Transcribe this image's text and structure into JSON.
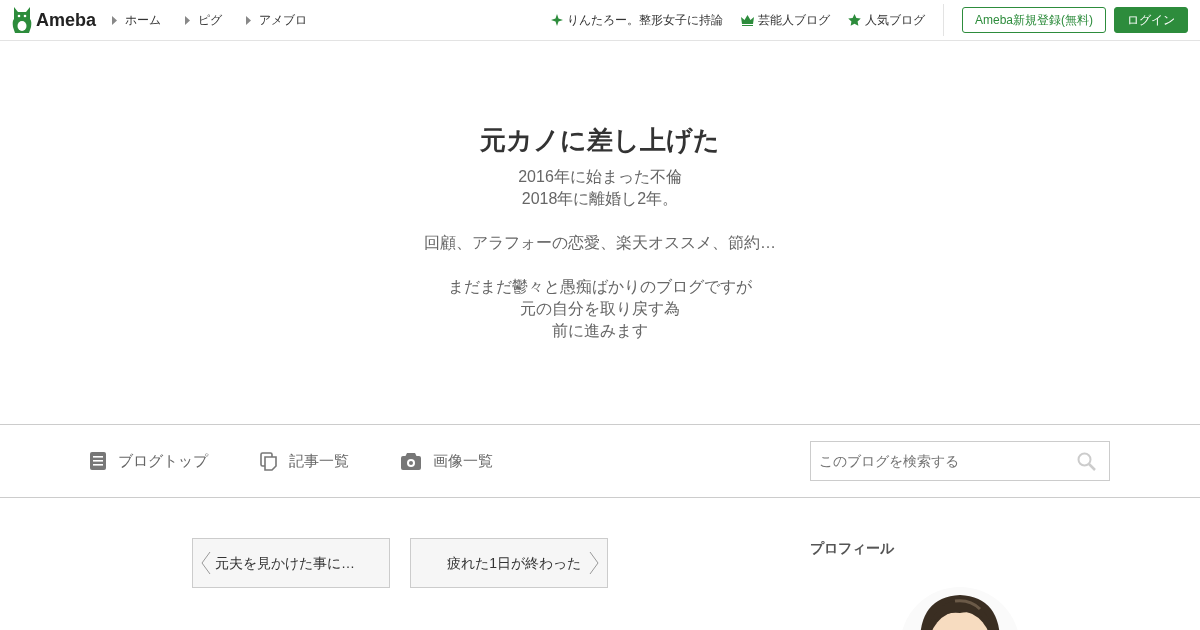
{
  "header": {
    "logo": "Ameba",
    "breadcrumbs": [
      "ホーム",
      "ピグ",
      "アメブロ"
    ],
    "links": [
      {
        "kind": "sparkle",
        "label": "りんたろー。整形女子に持論"
      },
      {
        "kind": "crown",
        "label": "芸能人ブログ"
      },
      {
        "kind": "star",
        "label": "人気ブログ"
      }
    ],
    "register_button": "Ameba新規登録(無料)",
    "login_button": "ログイン"
  },
  "blog": {
    "title": "元カノに差し上げた",
    "description": [
      [
        "2016年に始まった不倫",
        "2018年に離婚し2年。"
      ],
      [
        "回顧、アラフォーの恋愛、楽天オススメ、節約…"
      ],
      [
        "まだまだ鬱々と愚痴ばかりのブログですが",
        "元の自分を取り戻す為",
        "前に進みます"
      ]
    ]
  },
  "blog_nav": {
    "items": [
      {
        "kind": "document",
        "label": "ブログトップ"
      },
      {
        "kind": "pages",
        "label": "記事一覧"
      },
      {
        "kind": "camera",
        "label": "画像一覧"
      }
    ],
    "search": {
      "placeholder": "このブログを検索する"
    }
  },
  "pager": {
    "previous": "元夫を見かけた事に…",
    "next": "疲れた1日が終わった"
  },
  "sidebar": {
    "heading": "プロフィール"
  }
}
